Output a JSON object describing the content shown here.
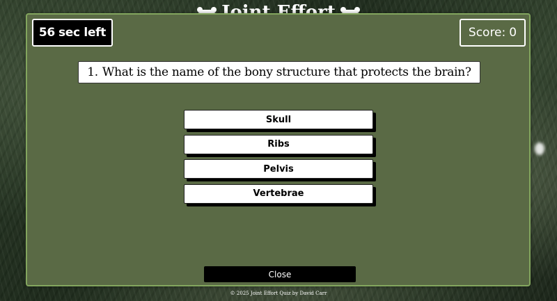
{
  "header": {
    "title": "Joint Effort",
    "icons": [
      "bone-icon",
      "bone-icon"
    ]
  },
  "quiz": {
    "timer": {
      "value": "56",
      "suffix": "sec left"
    },
    "score": {
      "label": "Score:",
      "value": "0"
    },
    "question": {
      "number": "1.",
      "text": "What is the name of the bony structure that protects the brain?"
    },
    "answers": [
      {
        "label": "Skull"
      },
      {
        "label": "Ribs"
      },
      {
        "label": "Pelvis"
      },
      {
        "label": "Vertebrae"
      }
    ],
    "close_label": "Close"
  },
  "footer": {
    "text": "© 2025 Joint Effort Quiz by David Carr"
  },
  "colors": {
    "modal_bg": "#5a6a45",
    "modal_border": "#83a65e",
    "button_bg": "#ffffff",
    "close_bg": "#000000"
  }
}
